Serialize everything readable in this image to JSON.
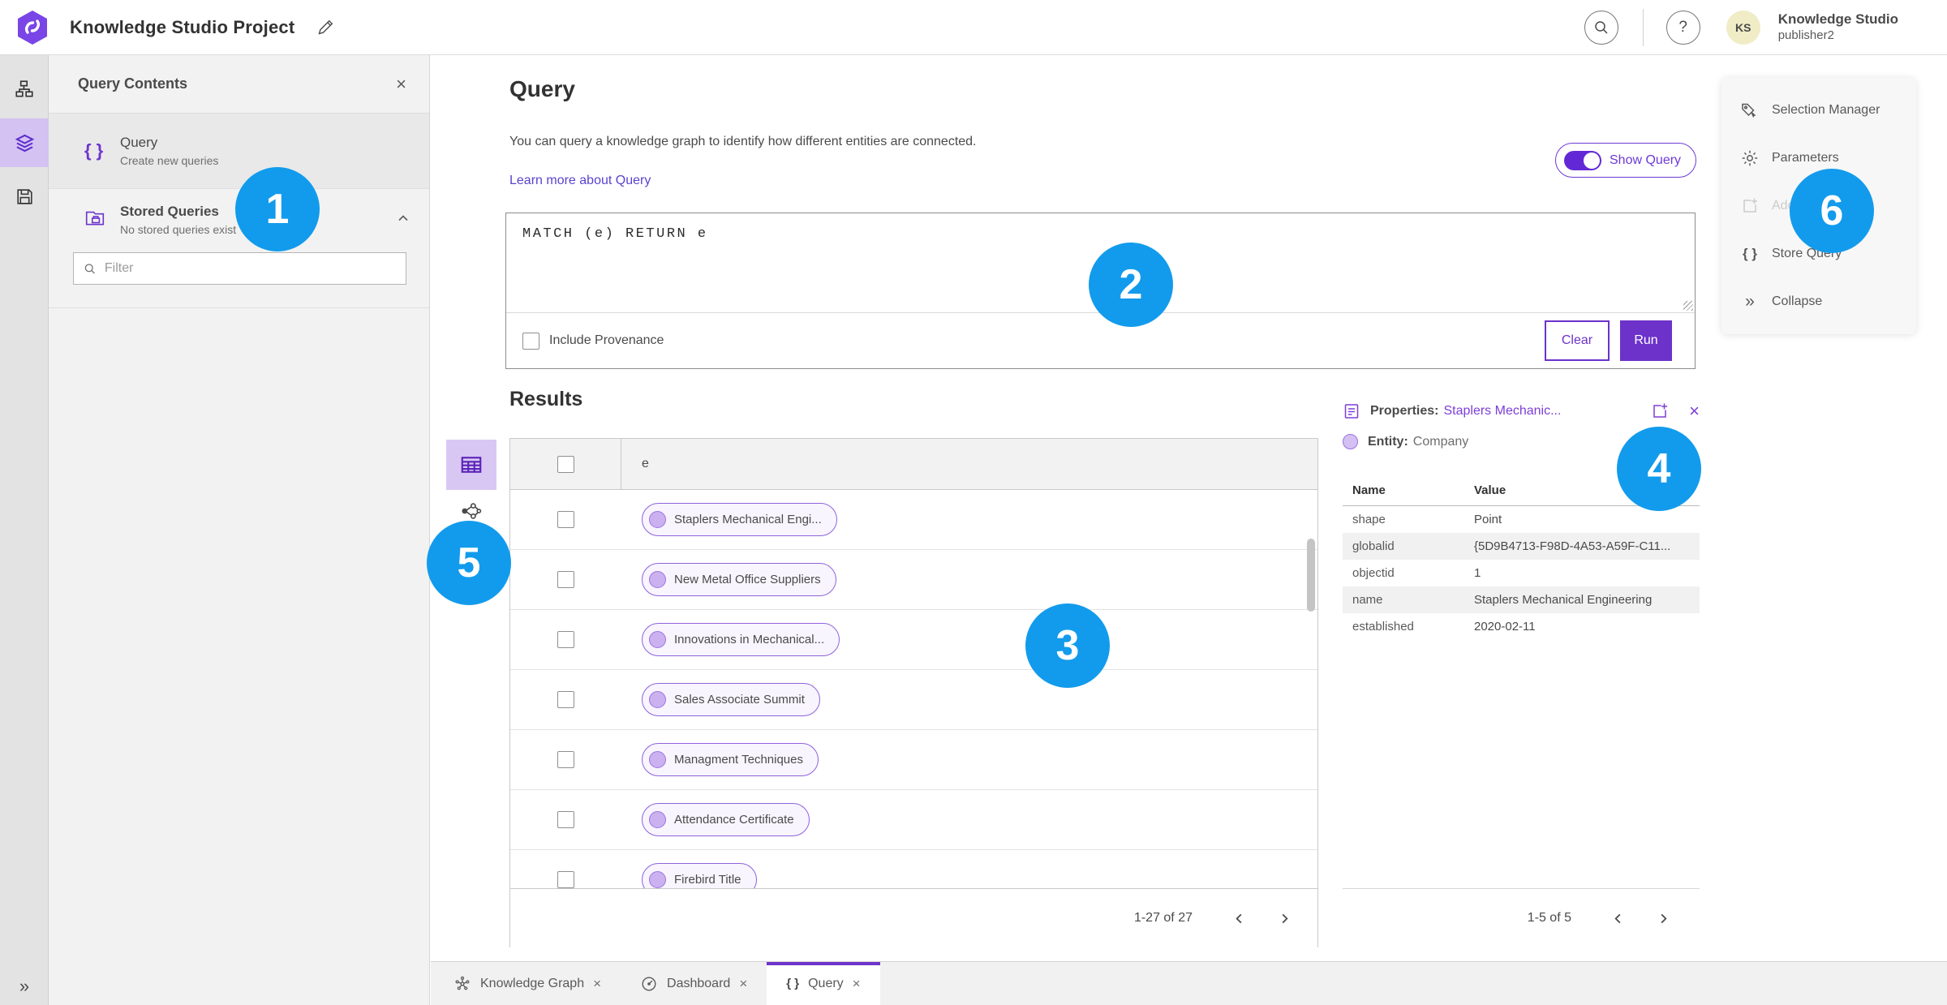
{
  "header": {
    "title": "Knowledge Studio Project",
    "user": {
      "name": "Knowledge Studio",
      "role": "publisher2",
      "initials": "KS"
    }
  },
  "icons": {
    "close": "×",
    "help": "?",
    "braces": "{ }",
    "collapse": "»"
  },
  "query_contents": {
    "title": "Query Contents",
    "query_item": {
      "label": "Query",
      "sublabel": "Create new queries"
    },
    "stored_item": {
      "label": "Stored Queries",
      "sublabel": "No stored queries exist"
    },
    "filter_placeholder": "Filter"
  },
  "query_panel": {
    "heading": "Query",
    "description": "You can query a knowledge graph to identify how different entities are connected.",
    "learn_more": "Learn more about Query",
    "show_query": "Show Query",
    "query_text": "MATCH (e) RETURN e",
    "include_provenance": "Include Provenance",
    "clear": "Clear",
    "run": "Run"
  },
  "results": {
    "heading": "Results",
    "column": "e",
    "rows": [
      "Staplers Mechanical Engi...",
      "New Metal Office Suppliers",
      "Innovations in Mechanical...",
      "Sales Associate Summit",
      "Managment Techniques",
      "Attendance Certificate",
      "Firebird Title"
    ],
    "pagination": "1-27 of 27"
  },
  "properties": {
    "label": "Properties:",
    "entity_name": "Staplers Mechanic...",
    "entity_label": "Entity:",
    "entity_type": "Company",
    "col_name": "Name",
    "col_value": "Value",
    "rows": [
      {
        "name": "shape",
        "value": "Point"
      },
      {
        "name": "globalid",
        "value": "{5D9B4713-F98D-4A53-A59F-C11..."
      },
      {
        "name": "objectid",
        "value": "1"
      },
      {
        "name": "name",
        "value": "Staplers Mechanical Engineering"
      },
      {
        "name": "established",
        "value": "2020-02-11"
      }
    ],
    "pagination": "1-5 of 5"
  },
  "action_menu": {
    "items": [
      {
        "label": "Selection Manager"
      },
      {
        "label": "Parameters"
      },
      {
        "label": "Add To Map"
      },
      {
        "label": "Store Query"
      },
      {
        "label": "Collapse"
      }
    ]
  },
  "tabs": [
    {
      "label": "Knowledge Graph"
    },
    {
      "label": "Dashboard"
    },
    {
      "label": "Query"
    }
  ],
  "badges": [
    "1",
    "2",
    "3",
    "4",
    "5",
    "6"
  ],
  "colors": {
    "accent_purple": "#6C32CA",
    "badge_blue": "#129BEC",
    "link_purple": "#5A43CF",
    "properties_purple": "#7D3FD6",
    "chip_border": "#8F62DD"
  }
}
